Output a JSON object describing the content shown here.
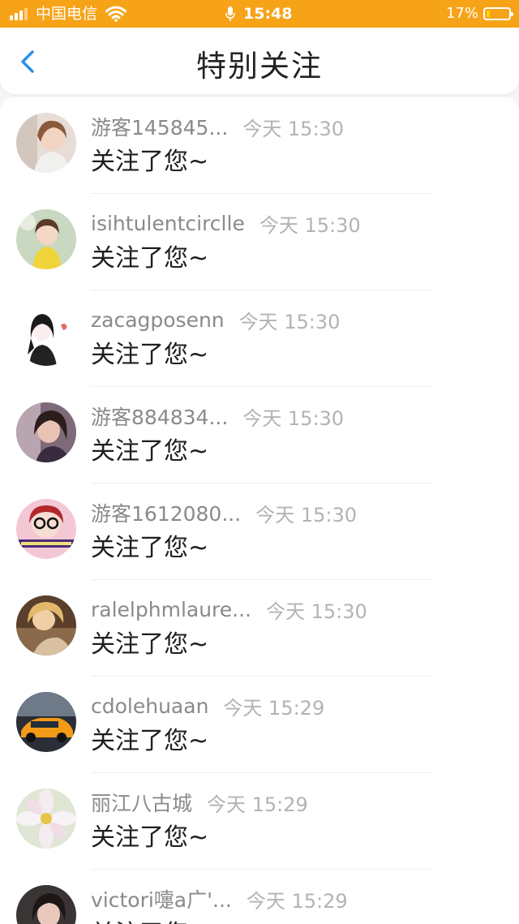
{
  "status_bar": {
    "carrier": "中国电信",
    "time": "15:48",
    "battery": "17%",
    "battery_level": 0.17,
    "colors": {
      "background": "#f7a318"
    }
  },
  "header": {
    "title": "特别关注",
    "back_icon": "chevron-left-icon",
    "colors": {
      "back": "#2d8fe8"
    }
  },
  "items": [
    {
      "username": "游客145845...",
      "time": "今天 15:30",
      "message": "关注了您~"
    },
    {
      "username": "isihtulentcirclle",
      "time": "今天 15:30",
      "message": "关注了您~"
    },
    {
      "username": "zacagposenn",
      "time": "今天 15:30",
      "message": "关注了您~"
    },
    {
      "username": "游客884834...",
      "time": "今天 15:30",
      "message": "关注了您~"
    },
    {
      "username": "游客1612080...",
      "time": "今天 15:30",
      "message": "关注了您~"
    },
    {
      "username": "ralelphmlaure...",
      "time": "今天 15:30",
      "message": "关注了您~"
    },
    {
      "username": "cdolehuaan",
      "time": "今天 15:29",
      "message": "关注了您~"
    },
    {
      "username": "丽江八古城",
      "time": "今天 15:29",
      "message": "关注了您~"
    },
    {
      "username": "victori嚏a广'...",
      "time": "今天 15:29",
      "message": "关注了您~"
    }
  ]
}
